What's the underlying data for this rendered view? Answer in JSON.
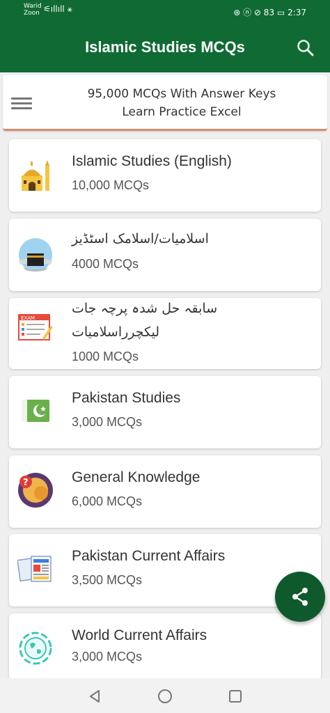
{
  "status_bar": {
    "carrier_line1": "Warid",
    "carrier_line2": "Zoon",
    "left_icons": "⚟ıllıll ⚹",
    "right_text": "⊛ ⓝ ⊘ 83 ▭ 2:37"
  },
  "app_bar": {
    "title": "Islamic Studies MCQs",
    "search_icon": "search-icon",
    "color": "#0f6b33"
  },
  "banner": {
    "line1": "95,000 MCQs With Answer Keys",
    "line2": "Learn Practice Excel",
    "menu_icon": "hamburger-menu-icon"
  },
  "categories": [
    {
      "title": "Islamic Studies (English)",
      "count": "10,000 MCQs",
      "icon": "mosque-icon"
    },
    {
      "title": "اسلامیات/اسلامک اسٹڈیز",
      "count": "4000 MCQs",
      "icon": "kaaba-icon"
    },
    {
      "title": "سابقہ حل شدہ پرچہ جات",
      "title2": "لیکچرراسلامیات",
      "count": "1000 MCQs",
      "icon": "exam-paper-icon"
    },
    {
      "title": "Pakistan Studies",
      "count": "3,000 MCQs",
      "icon": "pakistan-flag-icon"
    },
    {
      "title": "General Knowledge",
      "count": "6,000 MCQs",
      "icon": "knowledge-icon"
    },
    {
      "title": "Pakistan Current Affairs",
      "count": "3,500 MCQs",
      "icon": "newspaper-icon"
    },
    {
      "title": "World Current Affairs",
      "count": "3,000 MCQs",
      "icon": "globe-icon"
    }
  ],
  "fab": {
    "icon": "share-icon"
  },
  "nav_bar": {
    "back": "back-icon",
    "home": "home-icon",
    "recents": "recents-icon"
  }
}
